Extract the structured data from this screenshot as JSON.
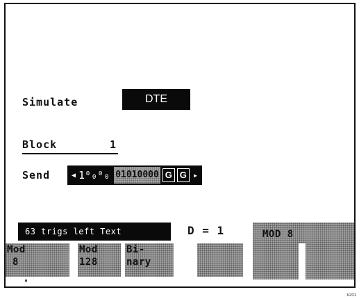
{
  "simulate": {
    "label": "Simulate",
    "value": "DTE"
  },
  "block": {
    "label": "Block",
    "value": "1"
  },
  "send": {
    "label": "Send",
    "left_arrow": "◀",
    "digits": "1⁰₀⁰₀",
    "bits": "01010000",
    "g1": "G",
    "g2": "G",
    "right_arrow": "▸"
  },
  "status": {
    "trigs": "63 trigs left Text",
    "d_label": "D = 1"
  },
  "softkeys": [
    {
      "line1": "Mod",
      "line2": "8"
    },
    {
      "line1": "Mod",
      "line2": "128"
    },
    {
      "line1": "Bi-",
      "line2": "nary"
    },
    {
      "line1": "",
      "line2": ""
    },
    {
      "line1": "MOD 8",
      "line2": ""
    }
  ],
  "footer": {
    "code": "k201"
  },
  "colors": {
    "background": "#ffffff",
    "ink": "#0a0a0a",
    "shade": "#9e9e9e"
  }
}
